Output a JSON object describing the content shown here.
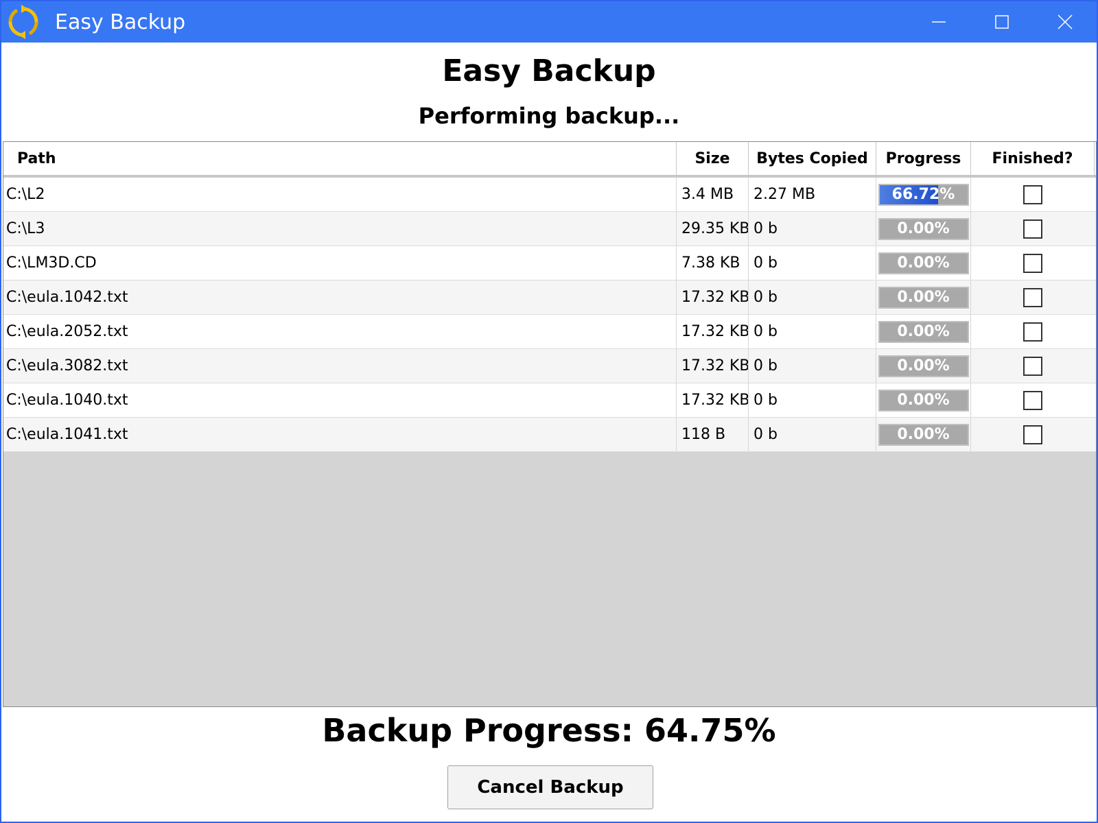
{
  "window": {
    "title": "Easy Backup",
    "icon": "sync-arrows-icon",
    "controls": [
      "minimize-icon",
      "maximize-icon",
      "close-icon"
    ],
    "accent_color": "#3777f3"
  },
  "header": {
    "title": "Easy Backup",
    "status": "Performing backup..."
  },
  "table": {
    "columns": [
      "Path",
      "Size",
      "Bytes Copied",
      "Progress",
      "Finished?"
    ],
    "rows": [
      {
        "path": "C:\\L2",
        "size": "3.4 MB",
        "bytes": "2.27 MB",
        "progress": "66.72%",
        "progress_value": 0.6672,
        "finished": false
      },
      {
        "path": "C:\\L3",
        "size": "29.35 KB",
        "bytes": "0 b",
        "progress": "0.00%",
        "progress_value": 0,
        "finished": false
      },
      {
        "path": "C:\\LM3D.CD",
        "size": "7.38 KB",
        "bytes": "0 b",
        "progress": "0.00%",
        "progress_value": 0,
        "finished": false
      },
      {
        "path": "C:\\eula.1042.txt",
        "size": "17.32 KB",
        "bytes": "0 b",
        "progress": "0.00%",
        "progress_value": 0,
        "finished": false
      },
      {
        "path": "C:\\eula.2052.txt",
        "size": "17.32 KB",
        "bytes": "0 b",
        "progress": "0.00%",
        "progress_value": 0,
        "finished": false
      },
      {
        "path": "C:\\eula.3082.txt",
        "size": "17.32 KB",
        "bytes": "0 b",
        "progress": "0.00%",
        "progress_value": 0,
        "finished": false
      },
      {
        "path": "C:\\eula.1040.txt",
        "size": "17.32 KB",
        "bytes": "0 b",
        "progress": "0.00%",
        "progress_value": 0,
        "finished": false
      },
      {
        "path": "C:\\eula.1041.txt",
        "size": "118 B",
        "bytes": "0 b",
        "progress": "0.00%",
        "progress_value": 0,
        "finished": false
      }
    ]
  },
  "footer": {
    "total_progress": "Backup Progress: 64.75%",
    "cancel_label": "Cancel Backup"
  }
}
